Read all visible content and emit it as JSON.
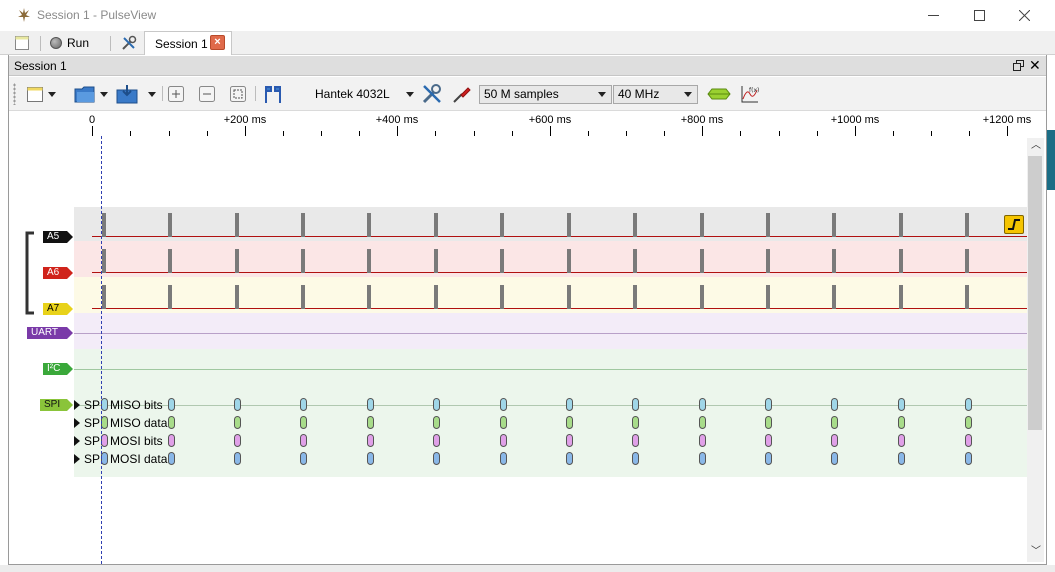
{
  "window": {
    "title": "Session 1 - PulseView",
    "icon": "pulseview-app-icon"
  },
  "tabbar": {
    "run_label": "Run",
    "session_tab_label": "Session 1",
    "close_symbol": "×"
  },
  "dock": {
    "title": "Session 1",
    "close_symbol": "✕"
  },
  "toolbar": {
    "device": "Hantek 4032L",
    "samples": "50 M samples",
    "samplerate": "40 MHz"
  },
  "ruler": {
    "ticks": [
      "0",
      "+200 ms",
      "+400 ms",
      "+600 ms",
      "+800 ms",
      "+1000 ms",
      "+1200 ms"
    ]
  },
  "channels": [
    {
      "name": "A5",
      "color": "#111111",
      "text_color": "#ffffff"
    },
    {
      "name": "A6",
      "color": "#d0231b",
      "text_color": "#ffffff"
    },
    {
      "name": "A7",
      "color": "#e8d21a",
      "text_color": "#000000"
    }
  ],
  "decoders": [
    {
      "name": "UART",
      "color": "#7a3aa8"
    },
    {
      "name": "I²C",
      "color": "#3aa83a"
    },
    {
      "name": "SPI",
      "color": "#8ac43a"
    }
  ],
  "spi_rows": [
    {
      "label": "SPI: MISO bits",
      "color": "#9fd6e8"
    },
    {
      "label": "SPI: MISO data",
      "color": "#a8dc8a"
    },
    {
      "label": "SPI: MOSI bits",
      "color": "#e0a0e8"
    },
    {
      "label": "SPI: MOSI data",
      "color": "#8ab8e8"
    }
  ],
  "colors": {
    "row_a5_bg": "#e9e9e9",
    "row_a6_bg": "#fbe6e6",
    "row_a7_bg": "#fdfae6",
    "row_uart_bg": "#f3ecf8",
    "row_i2c_bg": "#ecf6ec",
    "signal_red": "#b01010"
  }
}
